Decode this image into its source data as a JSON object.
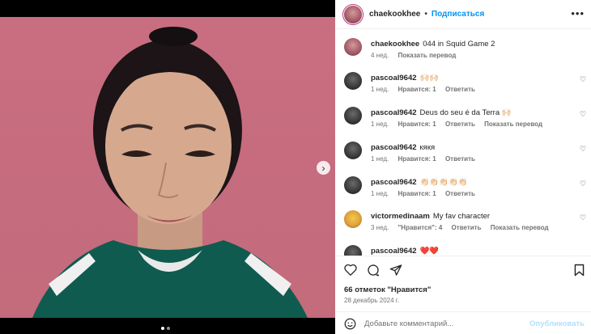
{
  "header": {
    "username": "chaekookhee",
    "separator": "•",
    "follow_label": "Подписаться",
    "more_icon": "more-horizontal-icon"
  },
  "caption": {
    "username": "chaekookhee",
    "text": "044 in Squid Game 2",
    "time": "4 нед.",
    "translate": "Показать перевод"
  },
  "comments": [
    {
      "username": "pascoal9642",
      "text": "🙌🏻🙌🏻",
      "time": "1 нед.",
      "likes": "Нравится: 1",
      "reply": "Ответить",
      "translate": "",
      "avatar": "dark"
    },
    {
      "username": "pascoal9642",
      "text": "Deus do seu é da Terra 🙌🏻",
      "time": "1 нед.",
      "likes": "Нравится: 1",
      "reply": "Ответить",
      "translate": "Показать перевод",
      "avatar": "dark"
    },
    {
      "username": "pascoal9642",
      "text": "кякя",
      "time": "1 нед.",
      "likes": "Нравится: 1",
      "reply": "Ответить",
      "translate": "",
      "avatar": "dark"
    },
    {
      "username": "pascoal9642",
      "text": "👏🏻👏🏻👏🏻👏🏻👏🏻",
      "time": "1 нед.",
      "likes": "Нравится: 1",
      "reply": "Ответить",
      "translate": "",
      "avatar": "dark"
    },
    {
      "username": "victormedinaam",
      "text": "My fav character",
      "time": "3 нед.",
      "likes": "\"Нравится\": 4",
      "reply": "Ответить",
      "translate": "Показать перевод",
      "avatar": "smile"
    },
    {
      "username": "pascoal9642",
      "text": "❤️❤️",
      "time": "",
      "likes": "",
      "reply": "",
      "translate": "",
      "avatar": "dark"
    }
  ],
  "actions": {
    "likes_text": "66 отметок \"Нравится\"",
    "date": "28 декабрь 2024 г.",
    "comment_placeholder": "Добавьте комментарий...",
    "post_label": "Опубликовать"
  },
  "media": {
    "carousel_pages": 2,
    "active_page": 1
  },
  "colors": {
    "accent": "#0095f6",
    "post_disabled": "#b2dffc",
    "background_pink": "#c96e80"
  }
}
